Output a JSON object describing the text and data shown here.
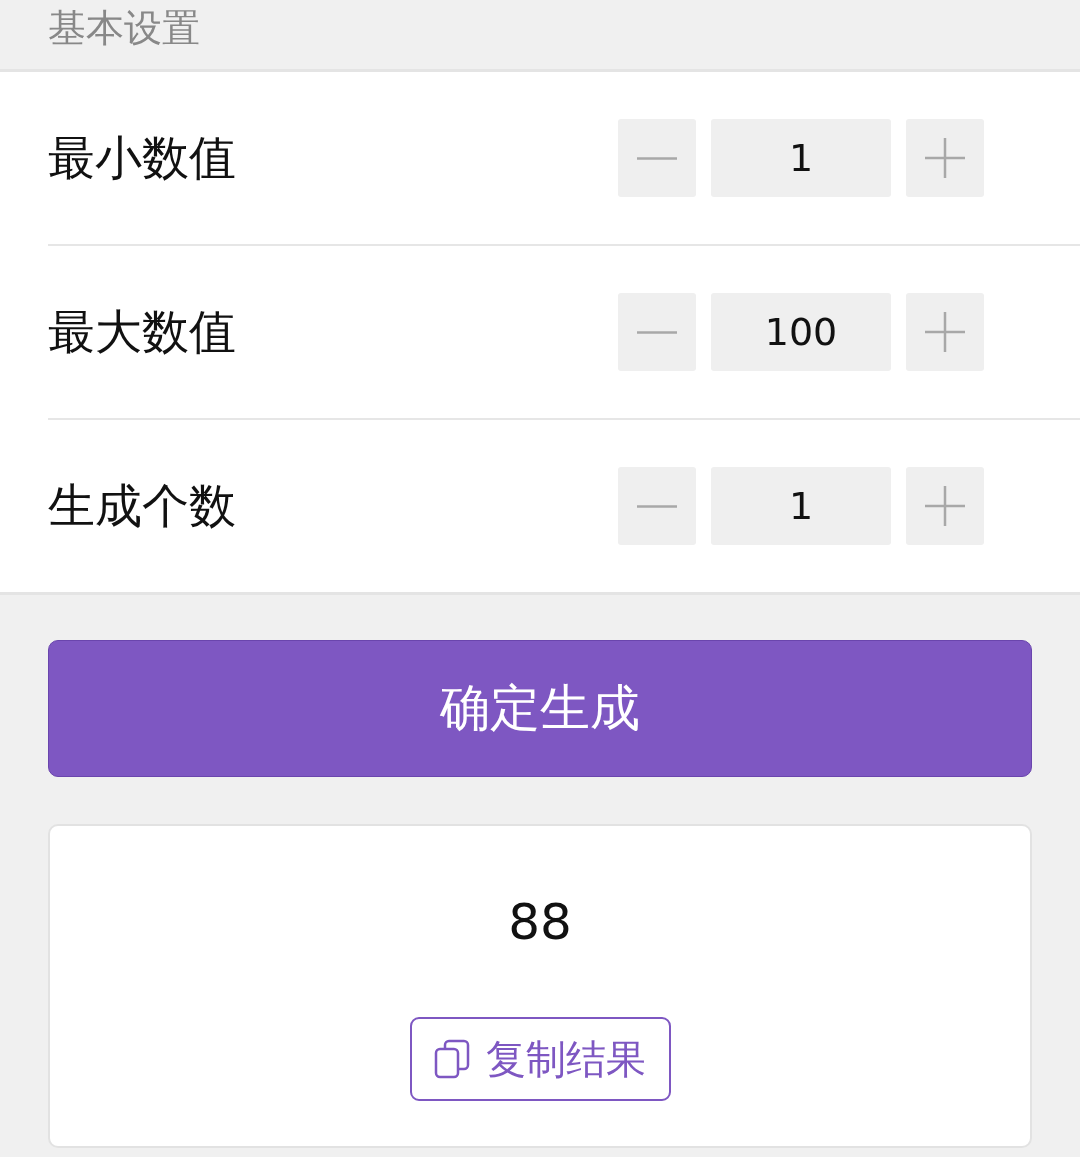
{
  "section_title": "基本设置",
  "settings": [
    {
      "label": "最小数值",
      "value": "1"
    },
    {
      "label": "最大数值",
      "value": "100"
    },
    {
      "label": "生成个数",
      "value": "1"
    }
  ],
  "generate_button": "确定生成",
  "result": {
    "value": "88",
    "copy_button": "复制结果"
  }
}
